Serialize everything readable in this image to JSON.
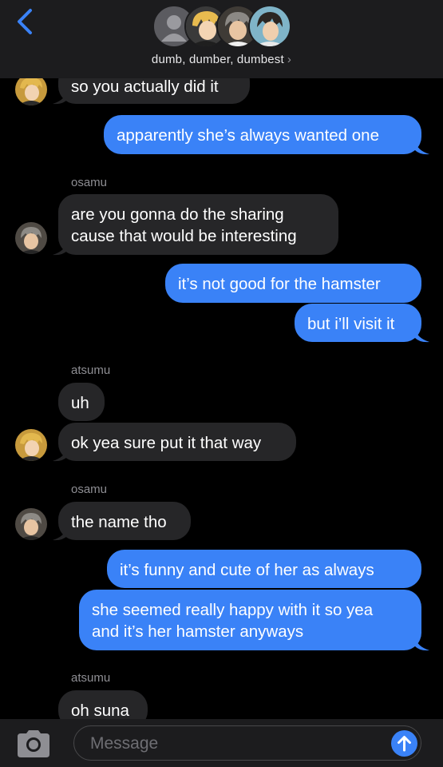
{
  "header": {
    "group_name": "dumb, dumber, dumbest",
    "chevron": "›",
    "avatars": [
      "generic-person-icon",
      "blonde-boy-avatar",
      "gray-hair-boy-avatar",
      "dark-hair-boy-avatar"
    ]
  },
  "messages": [
    {
      "type": "received",
      "text": "so you actually did it",
      "avatar": "blonde-boy-avatar"
    },
    {
      "type": "sent",
      "text": "apparently she’s always wanted one"
    },
    {
      "type": "sender",
      "text": "osamu"
    },
    {
      "type": "received",
      "lines": [
        "are you gonna do the sharing",
        "cause that would be interesting"
      ],
      "avatar": "gray-hair-boy-avatar"
    },
    {
      "type": "sent",
      "text": "it’s not good for the hamster"
    },
    {
      "type": "sent",
      "text": "but i’ll visit it"
    },
    {
      "type": "sender",
      "text": "atsumu"
    },
    {
      "type": "received",
      "text": "uh"
    },
    {
      "type": "received",
      "text": "ok yea sure put it that way",
      "avatar": "blonde-boy-avatar"
    },
    {
      "type": "sender",
      "text": "osamu"
    },
    {
      "type": "received",
      "text": "the name tho",
      "avatar": "gray-hair-boy-avatar"
    },
    {
      "type": "sent",
      "text": "it’s funny and cute of her as always"
    },
    {
      "type": "sent",
      "lines": [
        "she seemed really happy with it so yea",
        "and it’s her hamster anyways"
      ]
    },
    {
      "type": "sender",
      "text": "atsumu"
    },
    {
      "type": "received",
      "text": "oh suna"
    }
  ],
  "composer": {
    "placeholder": "Message",
    "camera_icon": "camera-icon",
    "send_icon": "arrow-up-icon"
  },
  "colors": {
    "sent_bubble": "#3a82f7",
    "received_bubble": "#262628",
    "background": "#000000",
    "accent": "#3a82f7"
  }
}
